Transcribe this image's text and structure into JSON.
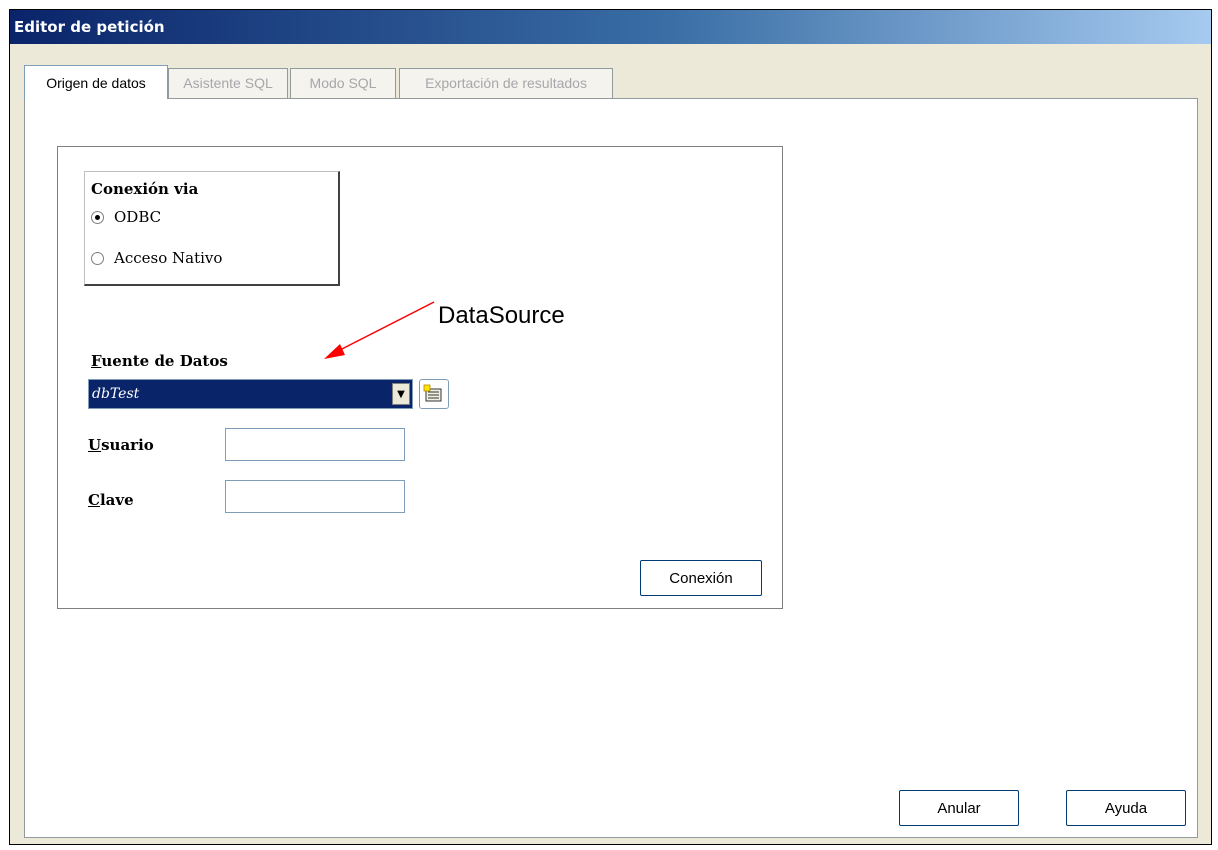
{
  "window": {
    "title": "Editor de petición"
  },
  "tabs": [
    {
      "label": "Origen de datos",
      "active": true
    },
    {
      "label": "Asistente SQL",
      "active": false
    },
    {
      "label": "Modo SQL",
      "active": false
    },
    {
      "label": "Exportación de resultados",
      "active": false
    }
  ],
  "connection": {
    "title": "Conexión via",
    "options": [
      {
        "label": "ODBC",
        "selected": true
      },
      {
        "label": "Acceso Nativo",
        "selected": false
      }
    ]
  },
  "datasource": {
    "label_mnemonic": "F",
    "label_rest": "uente de Datos",
    "value": "dbTest"
  },
  "user": {
    "label_mnemonic": "U",
    "label_rest": "suario",
    "value": ""
  },
  "password": {
    "label_mnemonic": "C",
    "label_rest": "lave",
    "value": ""
  },
  "buttons": {
    "connect": "Conexión",
    "cancel": "Anular",
    "help": "Ayuda"
  },
  "annotation": {
    "text": "DataSource",
    "color": "#ff0000"
  },
  "icons": {
    "dropdown": "chevron-down-icon",
    "datasource_browse": "database-browse-icon"
  }
}
